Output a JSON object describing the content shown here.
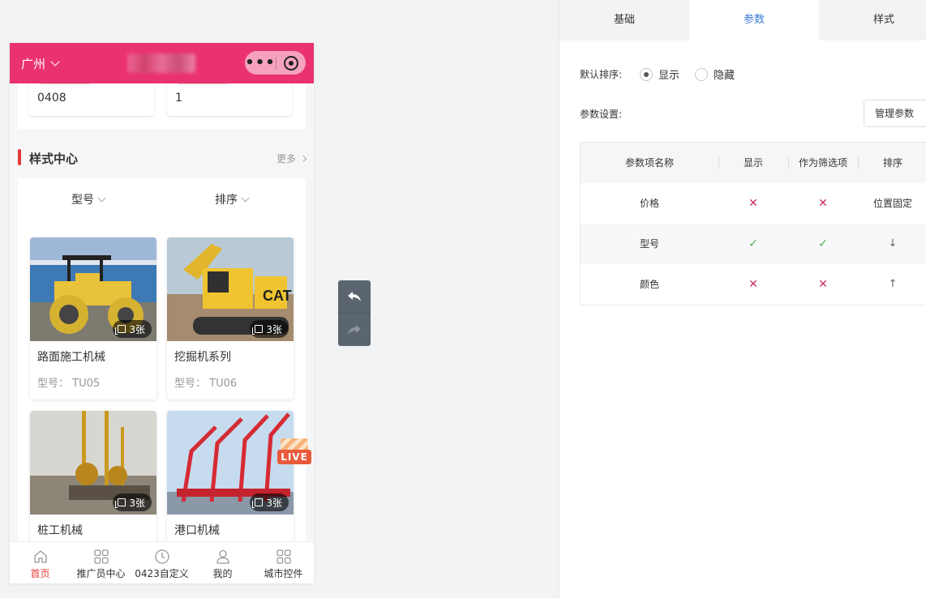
{
  "phone": {
    "city": "广州",
    "stats": [
      "0408",
      "1"
    ],
    "section": {
      "title": "样式中心",
      "more": "更多"
    },
    "filters": [
      "型号",
      "排序"
    ],
    "cards": [
      {
        "name": "路面施工机械",
        "model": "型号： TU05",
        "count": "3张",
        "image": "road-roller"
      },
      {
        "name": "挖掘机系列",
        "model": "型号： TU06",
        "count": "3张",
        "image": "excavator"
      },
      {
        "name": "桩工机械",
        "model": "",
        "count": "3张",
        "image": "pile-driver"
      },
      {
        "name": "港口机械",
        "model": "",
        "count": "3张",
        "image": "port-cranes"
      }
    ],
    "live_badge": "LIVE",
    "tabbar": [
      {
        "label": "首页",
        "icon": "home-icon",
        "active": true
      },
      {
        "label": "推广员中心",
        "icon": "grid-icon",
        "active": false
      },
      {
        "label": "0423自定义",
        "icon": "clock-icon",
        "active": false
      },
      {
        "label": "我的",
        "icon": "user-icon",
        "active": false
      },
      {
        "label": "城市控件",
        "icon": "grid-icon",
        "active": false
      }
    ],
    "accent_color": "#ea3272"
  },
  "panel": {
    "tabs": [
      "基础",
      "参数",
      "样式"
    ],
    "active_tab": "参数",
    "default_sort_label": "默认排序:",
    "radio_show": "显示",
    "radio_hide": "隐藏",
    "selected_radio": "显示",
    "param_settings_label": "参数设置:",
    "manage_button": "管理参数",
    "table": {
      "headers": [
        "参数项名称",
        "显示",
        "作为筛选项",
        "排序"
      ],
      "rows": [
        {
          "name": "价格",
          "show": "✕",
          "filter": "✕",
          "sort": "位置固定"
        },
        {
          "name": "型号",
          "show": "✓",
          "filter": "✓",
          "sort": "↓"
        },
        {
          "name": "颜色",
          "show": "✕",
          "filter": "✕",
          "sort": "↑"
        }
      ]
    }
  }
}
